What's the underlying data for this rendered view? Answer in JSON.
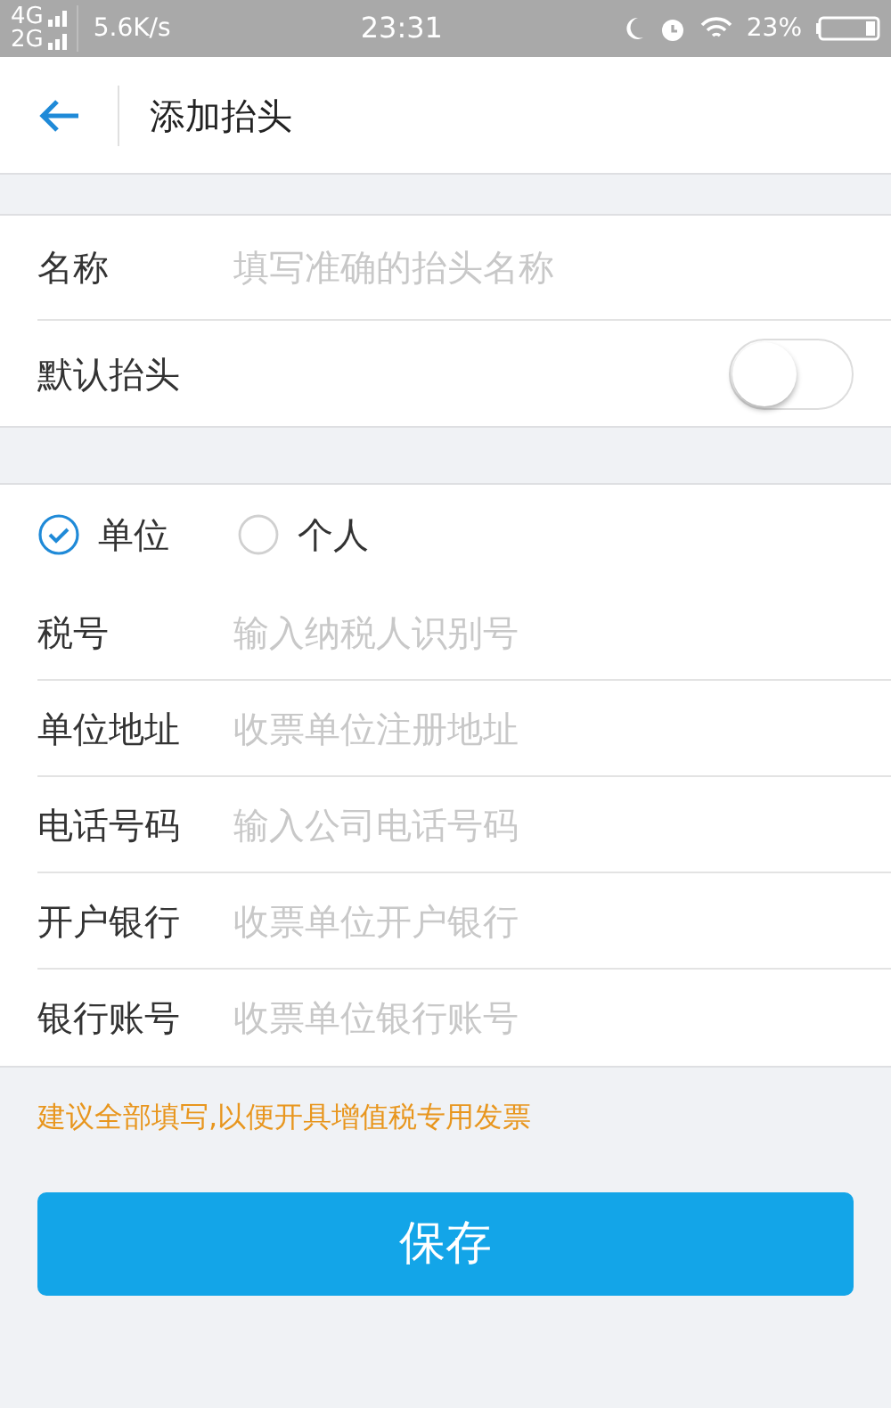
{
  "status_bar": {
    "network_1": "4G",
    "network_2": "2G",
    "speed": "5.6K/s",
    "time": "23:31",
    "battery": "23%"
  },
  "header": {
    "title": "添加抬头"
  },
  "basic_rows": [
    {
      "kind": "input",
      "label": "名称",
      "placeholder": "填写准确的抬头名称"
    },
    {
      "kind": "toggle",
      "label": "默认抬头",
      "on": false
    }
  ],
  "type_options": [
    {
      "label": "单位",
      "selected": true
    },
    {
      "label": "个人",
      "selected": false
    }
  ],
  "fields": [
    {
      "label": "税号",
      "placeholder": "输入纳税人识别号"
    },
    {
      "label": "单位地址",
      "placeholder": "收票单位注册地址"
    },
    {
      "label": "电话号码",
      "placeholder": "输入公司电话号码"
    },
    {
      "label": "开户银行",
      "placeholder": "收票单位开户银行"
    },
    {
      "label": "银行账号",
      "placeholder": "收票单位银行账号"
    }
  ],
  "note": "建议全部填写,以便开具增值税专用发票",
  "save_button": "保存"
}
